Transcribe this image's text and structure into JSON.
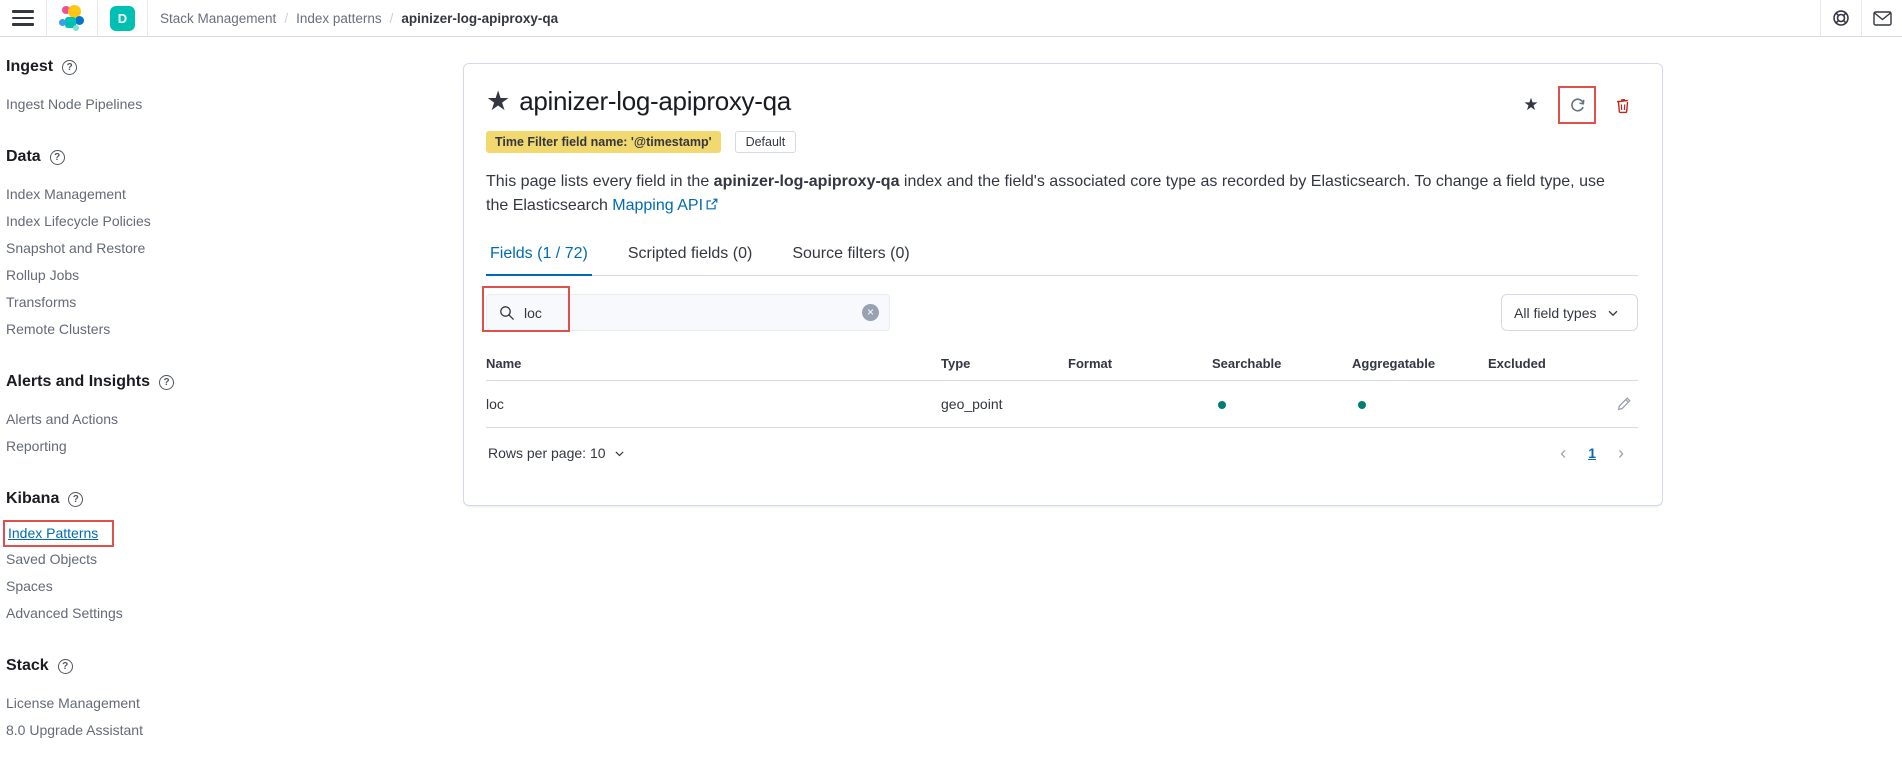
{
  "colors": {
    "accent_blue": "#006BB4",
    "teal_dot": "#017D73",
    "badge_yellow": "#F1D86F",
    "annotation_red": "#E0504A",
    "danger_red": "#BD271E",
    "space_badge_teal": "#00BFB3",
    "border_gray": "#D3DAE6"
  },
  "topbar": {
    "space_badge": "D",
    "breadcrumb_separator": "/",
    "breadcrumbs": [
      "Stack Management",
      "Index patterns",
      "apinizer-log-apiproxy-qa"
    ],
    "icons": [
      "hamburger-icon",
      "elastic-logo",
      "help-icon",
      "mail-icon"
    ]
  },
  "sidebar": {
    "sections": [
      {
        "title": "Ingest",
        "items": [
          {
            "label": "Ingest Node Pipelines"
          }
        ]
      },
      {
        "title": "Data",
        "items": [
          {
            "label": "Index Management"
          },
          {
            "label": "Index Lifecycle Policies"
          },
          {
            "label": "Snapshot and Restore"
          },
          {
            "label": "Rollup Jobs"
          },
          {
            "label": "Transforms"
          },
          {
            "label": "Remote Clusters"
          }
        ]
      },
      {
        "title": "Alerts and Insights",
        "items": [
          {
            "label": "Alerts and Actions"
          },
          {
            "label": "Reporting"
          }
        ]
      },
      {
        "title": "Kibana",
        "items": [
          {
            "label": "Index Patterns",
            "active": true
          },
          {
            "label": "Saved Objects"
          },
          {
            "label": "Spaces"
          },
          {
            "label": "Advanced Settings"
          }
        ]
      },
      {
        "title": "Stack",
        "items": [
          {
            "label": "License Management"
          },
          {
            "label": "8.0 Upgrade Assistant"
          }
        ]
      }
    ]
  },
  "panel": {
    "title": "apinizer-log-apiproxy-qa",
    "time_filter_badge": "Time Filter field name: '@timestamp'",
    "default_badge": "Default",
    "description": {
      "part1": "This page lists every field in the ",
      "bold": "apinizer-log-apiproxy-qa",
      "part2": " index and the field's associated core type as recorded by Elasticsearch. To change a field type, use the Elasticsearch ",
      "link": "Mapping API"
    },
    "tabs": [
      {
        "label": "Fields (1 / 72)",
        "active": true
      },
      {
        "label": "Scripted fields (0)"
      },
      {
        "label": "Source filters (0)"
      }
    ],
    "search": {
      "value": "loc"
    },
    "field_type_filter": "All field types",
    "table": {
      "headers": [
        "Name",
        "Type",
        "Format",
        "Searchable",
        "Aggregatable",
        "Excluded"
      ],
      "rows": [
        {
          "name": "loc",
          "type": "geo_point",
          "format": "",
          "searchable": true,
          "aggregatable": true,
          "excluded": ""
        }
      ]
    },
    "footer": {
      "rows_per_page": "Rows per page: 10",
      "page": "1"
    }
  }
}
